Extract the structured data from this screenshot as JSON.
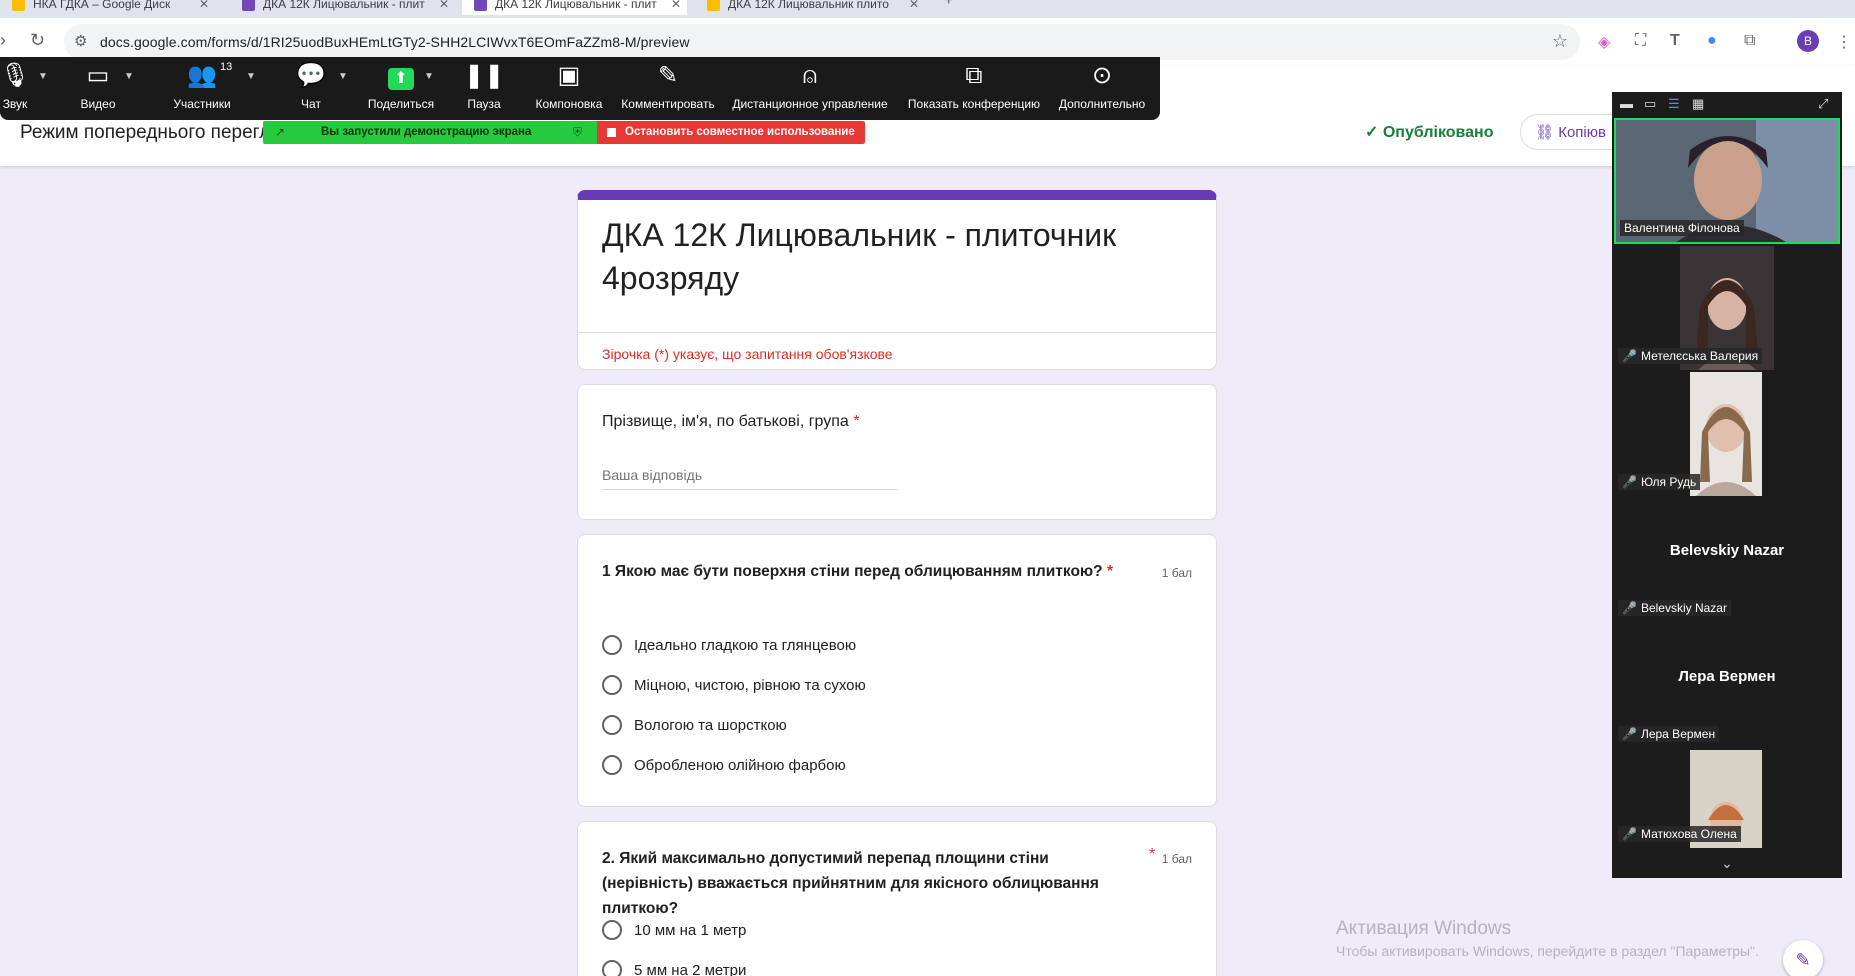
{
  "browser": {
    "tabs": [
      {
        "title": "НКА ГДКА – Google Диск",
        "favicon_color": "#fbbc04"
      },
      {
        "title": "ДКА 12К Лицювальник - плит",
        "favicon_color": "#7248b9"
      },
      {
        "title": "ДКА 12К Лицювальник - плит",
        "favicon_color": "#7248b9",
        "active": true
      },
      {
        "title": "ДКА 12К Лицювальник плито",
        "favicon_color": "#fbbc04"
      }
    ],
    "new_tab": "+",
    "url": "docs.google.com/forms/d/1RI25uodBuxHEmLtGTy2-SHH2LCIWvxT6EOmFaZZm8-M/preview",
    "profile_letter": "B"
  },
  "zoom": {
    "toolbar": [
      {
        "label": "Звук",
        "icon": "microphone-icon"
      },
      {
        "label": "Видео",
        "icon": "video-camera-icon"
      },
      {
        "label": "Участники",
        "icon": "participants-icon",
        "count": "13"
      },
      {
        "label": "Чат",
        "icon": "chat-icon"
      },
      {
        "label": "Поделиться",
        "icon": "share-screen-icon"
      },
      {
        "label": "Пауза",
        "icon": "pause-icon"
      },
      {
        "label": "Компоновка",
        "icon": "layout-icon"
      },
      {
        "label": "Комментировать",
        "icon": "annotate-pencil-icon"
      },
      {
        "label": "Дистанционное управление",
        "icon": "remote-control-mouse-icon"
      },
      {
        "label": "Показать конференцию",
        "icon": "show-meeting-icon"
      },
      {
        "label": "Дополнительно",
        "icon": "more-icon"
      }
    ],
    "share_banner": "Вы запустили демонстрацию экрана",
    "stop_share": "Остановить совместное использование",
    "participants": [
      {
        "name": "Валентина Філонова",
        "video": true,
        "speaking": true
      },
      {
        "name": "Метелєська Валерия",
        "video": true,
        "muted": true
      },
      {
        "name": "Юля Рудь",
        "video": true,
        "muted": true
      },
      {
        "name": "Belevskiy Nazar",
        "video": false,
        "muted": true
      },
      {
        "name": "Лера Вермен",
        "video": false,
        "muted": true
      },
      {
        "name": "Матюхова Олена",
        "video": true,
        "muted": true
      }
    ]
  },
  "forms": {
    "preview_title": "Режим попереднього перегл",
    "published_label": "Опубліковано",
    "copy_label": "Копіюв",
    "form_title": "ДКА 12К  Лицювальник - плиточник 4розряду",
    "required_note": "Зірочка (*) указує, що запитання обов'язкове",
    "name_question": {
      "text": "Прізвище, ім'я, по батькові,  група",
      "placeholder": "Ваша відповідь"
    },
    "questions": [
      {
        "text": "1 Якою має бути поверхня стіни перед облицюванням плиткою?",
        "points": "1 бал",
        "options": [
          "Ідеально гладкою та глянцевою",
          "Міцною, чистою, рівною та сухою",
          "Вологою та шорсткою",
          "Обробленою олійною фарбою"
        ]
      },
      {
        "text": "2. Який максимально допустимий перепад площини стіни (нерівність) вважається прийнятним для якісного облицювання плиткою?",
        "points": "1 бал",
        "options": [
          "10 мм на 1 метр",
          "5 мм на 2 метри"
        ]
      }
    ],
    "asterisk": "*"
  },
  "watermark": {
    "title": "Активация Windows",
    "subtitle": "Чтобы активировать Windows, перейдите в раздел \"Параметры\"."
  },
  "colors": {
    "accent": "#673ab7",
    "published": "#188038",
    "required": "#d93025",
    "zoom_green": "#23d959",
    "zoom_red": "#e53935"
  }
}
